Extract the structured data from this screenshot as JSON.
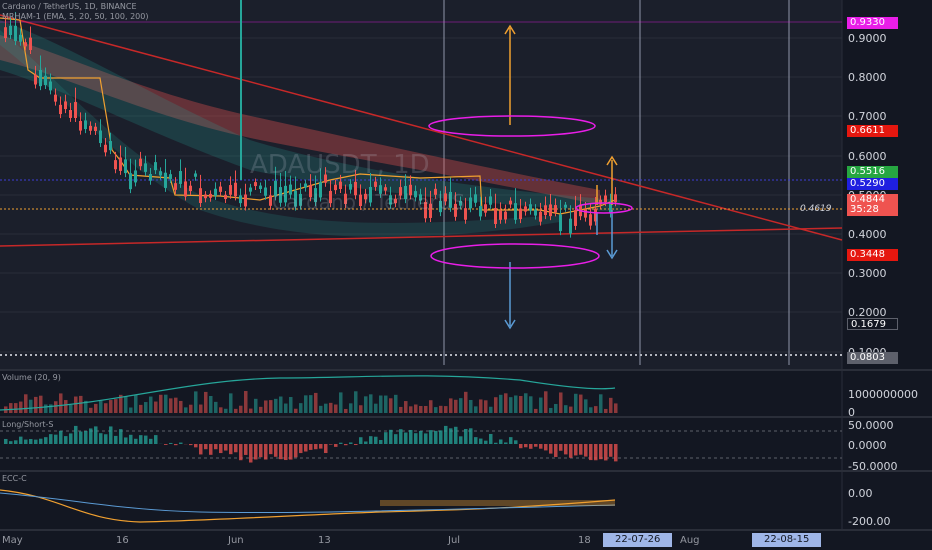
{
  "header": {
    "title": "Cardano / TetherUS, 1D, BINANCE",
    "indicator": "MRHAM-1 (EMA, 5, 20, 50, 100, 200)"
  },
  "watermark": {
    "symbol": "ADAUSDT, 1D",
    "name": "Cardano / TetherUS"
  },
  "panes": {
    "volume": {
      "title": "Volume (20, 9)",
      "ticks": [
        "1000000000",
        "0"
      ]
    },
    "longshort": {
      "title": "Long/Short-S",
      "ticks": [
        "50.0000",
        "0.0000",
        "-50.0000"
      ]
    },
    "ecc": {
      "title": "ECC-C",
      "ticks": [
        "0.00",
        "-200.00"
      ]
    }
  },
  "price_axis": {
    "ticks": [
      "0.9000",
      "0.8000",
      "0.7000",
      "0.6000",
      "0.5000",
      "0.4000",
      "0.3000",
      "0.2000",
      "0.1000"
    ],
    "tags": [
      {
        "value": "0.9330",
        "color": "#e91ee8"
      },
      {
        "value": "0.6611",
        "color": "#e5170f"
      },
      {
        "value": "0.5516",
        "color": "#26a641"
      },
      {
        "value": "0.5290",
        "color": "#1f1fe0"
      },
      {
        "value": "0.4844",
        "color": "#ef5350"
      },
      {
        "value": "35:28",
        "color": "#ef5350"
      },
      {
        "value": "0.3448",
        "color": "#e5170f"
      },
      {
        "value": "0.1679",
        "color": "#131722"
      },
      {
        "value": "0.0803",
        "color": "#5d606b"
      }
    ],
    "cursor_price": "0.4619"
  },
  "time_axis": {
    "ticks": [
      "May",
      "16",
      "Jun",
      "13",
      "Jul",
      "18",
      "Aug"
    ],
    "highlights": [
      "22-07-26",
      "22-08-15"
    ]
  },
  "chart_data": {
    "type": "line",
    "title": "Cardano / TetherUS, 1D, BINANCE",
    "x": [
      "May 1",
      "May 16",
      "Jun 1",
      "Jun 13",
      "Jul 1",
      "Jul 18",
      "Jul 26"
    ],
    "series": [
      {
        "name": "Cardano / TetherUS",
        "values": [
          0.91,
          0.6,
          0.5,
          0.52,
          0.45,
          0.47,
          0.48
        ]
      }
    ],
    "ylim": [
      0.06,
      0.96
    ],
    "levels": [
      0.933,
      0.6611,
      0.5516,
      0.529,
      0.4844,
      0.3448,
      0.1679,
      0.0803
    ]
  }
}
